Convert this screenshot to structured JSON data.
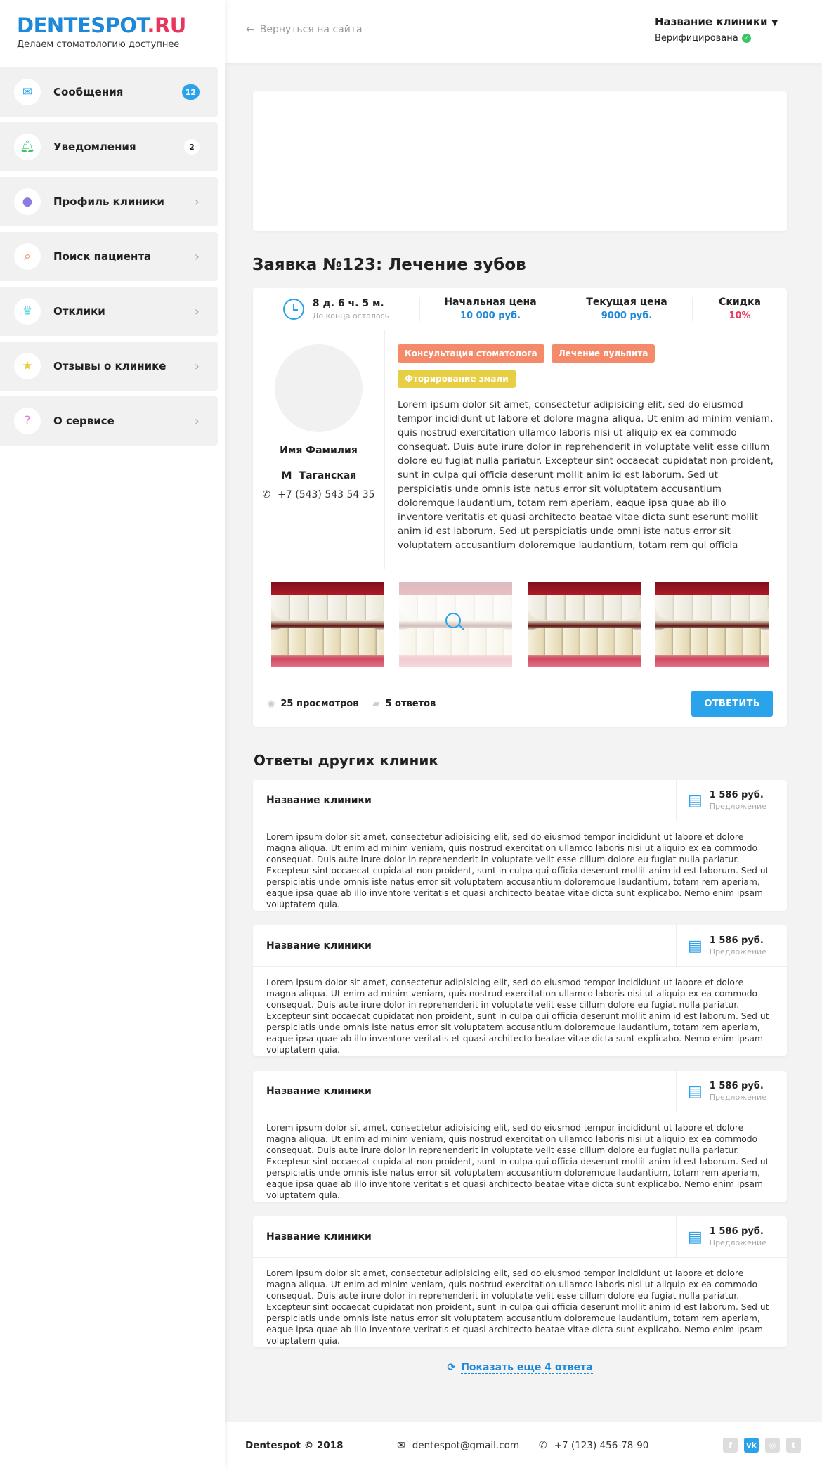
{
  "brand": {
    "logo_part1": "DENTESPOT",
    "logo_part2": ".RU",
    "tagline": "Делаем стоматологию доступнее"
  },
  "sidebar": {
    "items": [
      {
        "label": "Сообщения",
        "badge": "12",
        "icon": "envelope-icon",
        "icon_color": "#2aa3ea"
      },
      {
        "label": "Уведомления",
        "badge": "2",
        "icon": "bell-icon",
        "icon_color": "#3ac464"
      },
      {
        "label": "Профиль клиники",
        "icon": "user-icon",
        "icon_color": "#8c7be0"
      },
      {
        "label": "Поиск пациента",
        "icon": "search-icon",
        "icon_color": "#f58a6a"
      },
      {
        "label": "Отклики",
        "icon": "tooth-icon",
        "icon_color": "#5ed6e0"
      },
      {
        "label": "Отзывы о клинике",
        "icon": "star-icon",
        "icon_color": "#e6cf43"
      },
      {
        "label": "О сервисе",
        "icon": "question-icon",
        "icon_color": "#e07be0"
      }
    ]
  },
  "header": {
    "back_label": "Вернуться на сайта",
    "clinic_name": "Название клиники",
    "status": "Верифицирована"
  },
  "request": {
    "title": "Заявка №123: Лечение зубов",
    "time_left": "8 д. 6 ч. 5 м.",
    "time_sub": "До конца осталось",
    "start_price_label": "Начальная цена",
    "start_price": "10 000 руб.",
    "current_price_label": "Текущая цена",
    "current_price": "9000 руб.",
    "discount_label": "Скидка",
    "discount": "10%",
    "patient_name": "Имя Фамилия",
    "metro": "Таганская",
    "phone": "+7 (543) 543 54 35",
    "tags": [
      "Консультация стоматолога",
      "Лечение пульпита",
      "Фторирование змали"
    ],
    "description": "Lorem ipsum dolor sit amet, consectetur adipisicing elit, sed do eiusmod tempor incididunt ut labore et dolore magna aliqua. Ut enim ad minim veniam, quis nostrud exercitation ullamco laboris nisi ut aliquip ex ea commodo consequat. Duis aute irure dolor in reprehenderit in voluptate velit esse cillum dolore eu fugiat nulla pariatur. Excepteur sint occaecat cupidatat non proident, sunt in culpa qui officia deserunt mollit anim id est laborum. Sed ut perspiciatis unde omnis iste natus error sit voluptatem accusantium doloremque laudantium, totam rem aperiam, eaque ipsa quae ab illo inventore veritatis et quasi architecto beatae vitae dicta sunt eserunt mollit anim id est laborum. Sed ut perspiciatis unde omni iste natus error sit voluptatem accusantium doloremque laudantium, totam rem qui officia deserunt mollit anim id est laborum. Sed ut perspiciatis unde omnis iste",
    "views": "25 просмотров",
    "answers": "5 ответов",
    "reply_label": "ОТВЕТИТЬ"
  },
  "answers_section": {
    "title": "Ответы других клиник",
    "items": [
      {
        "clinic": "Название клиники",
        "price": "1 586 руб.",
        "price_sub": "Предложение",
        "text": "Lorem ipsum dolor sit amet, consectetur adipisicing elit, sed do eiusmod tempor incididunt ut labore et dolore magna aliqua. Ut enim ad minim veniam, quis nostrud exercitation ullamco laboris nisi ut aliquip ex ea commodo consequat. Duis aute irure dolor in reprehenderit in voluptate velit esse cillum dolore eu fugiat nulla pariatur. Excepteur sint occaecat cupidatat non proident, sunt in culpa qui officia deserunt mollit anim id est laborum. Sed ut perspiciatis unde omnis iste natus error sit voluptatem accusantium doloremque laudantium, totam rem aperiam, eaque ipsa quae ab illo inventore veritatis et quasi architecto beatae vitae dicta sunt explicabo. Nemo enim ipsam voluptatem quia."
      },
      {
        "clinic": "Название клиники",
        "price": "1 586 руб.",
        "price_sub": "Предложение",
        "text": "Lorem ipsum dolor sit amet, consectetur adipisicing elit, sed do eiusmod tempor incididunt ut labore et dolore magna aliqua. Ut enim ad minim veniam, quis nostrud exercitation ullamco laboris nisi ut aliquip ex ea commodo consequat. Duis aute irure dolor in reprehenderit in voluptate velit esse cillum dolore eu fugiat nulla pariatur. Excepteur sint occaecat cupidatat non proident, sunt in culpa qui officia deserunt mollit anim id est laborum. Sed ut perspiciatis unde omnis iste natus error sit voluptatem accusantium doloremque laudantium, totam rem aperiam, eaque ipsa quae ab illo inventore veritatis et quasi architecto beatae vitae dicta sunt explicabo. Nemo enim ipsam voluptatem quia."
      },
      {
        "clinic": "Название клиники",
        "price": "1 586 руб.",
        "price_sub": "Предложение",
        "text": "Lorem ipsum dolor sit amet, consectetur adipisicing elit, sed do eiusmod tempor incididunt ut labore et dolore magna aliqua. Ut enim ad minim veniam, quis nostrud exercitation ullamco laboris nisi ut aliquip ex ea commodo consequat. Duis aute irure dolor in reprehenderit in voluptate velit esse cillum dolore eu fugiat nulla pariatur. Excepteur sint occaecat cupidatat non proident, sunt in culpa qui officia deserunt mollit anim id est laborum. Sed ut perspiciatis unde omnis iste natus error sit voluptatem accusantium doloremque laudantium, totam rem aperiam, eaque ipsa quae ab illo inventore veritatis et quasi architecto beatae vitae dicta sunt explicabo. Nemo enim ipsam voluptatem quia."
      },
      {
        "clinic": "Название клиники",
        "price": "1 586 руб.",
        "price_sub": "Предложение",
        "text": "Lorem ipsum dolor sit amet, consectetur adipisicing elit, sed do eiusmod tempor incididunt ut labore et dolore magna aliqua. Ut enim ad minim veniam, quis nostrud exercitation ullamco laboris nisi ut aliquip ex ea commodo consequat. Duis aute irure dolor in reprehenderit in voluptate velit esse cillum dolore eu fugiat nulla pariatur. Excepteur sint occaecat cupidatat non proident, sunt in culpa qui officia deserunt mollit anim id est laborum. Sed ut perspiciatis unde omnis iste natus error sit voluptatem accusantium doloremque laudantium, totam rem aperiam, eaque ipsa quae ab illo inventore veritatis et quasi architecto beatae vitae dicta sunt explicabo. Nemo enim ipsam voluptatem quia."
      }
    ],
    "show_more": "Показать еще 4 ответа"
  },
  "footer": {
    "copyright": "Dentespot © 2018",
    "email": "dentespot@gmail.com",
    "phone": "+7 (123) 456-78-90",
    "socials": [
      "facebook-icon",
      "vk-icon",
      "instagram-icon",
      "twitter-icon"
    ]
  },
  "colors": {
    "accent": "#2aa3ea",
    "brand_red": "#e8365d",
    "discount": "#e8365d",
    "tag_orange": "#f58a6a",
    "tag_yellow": "#e6cf43"
  }
}
